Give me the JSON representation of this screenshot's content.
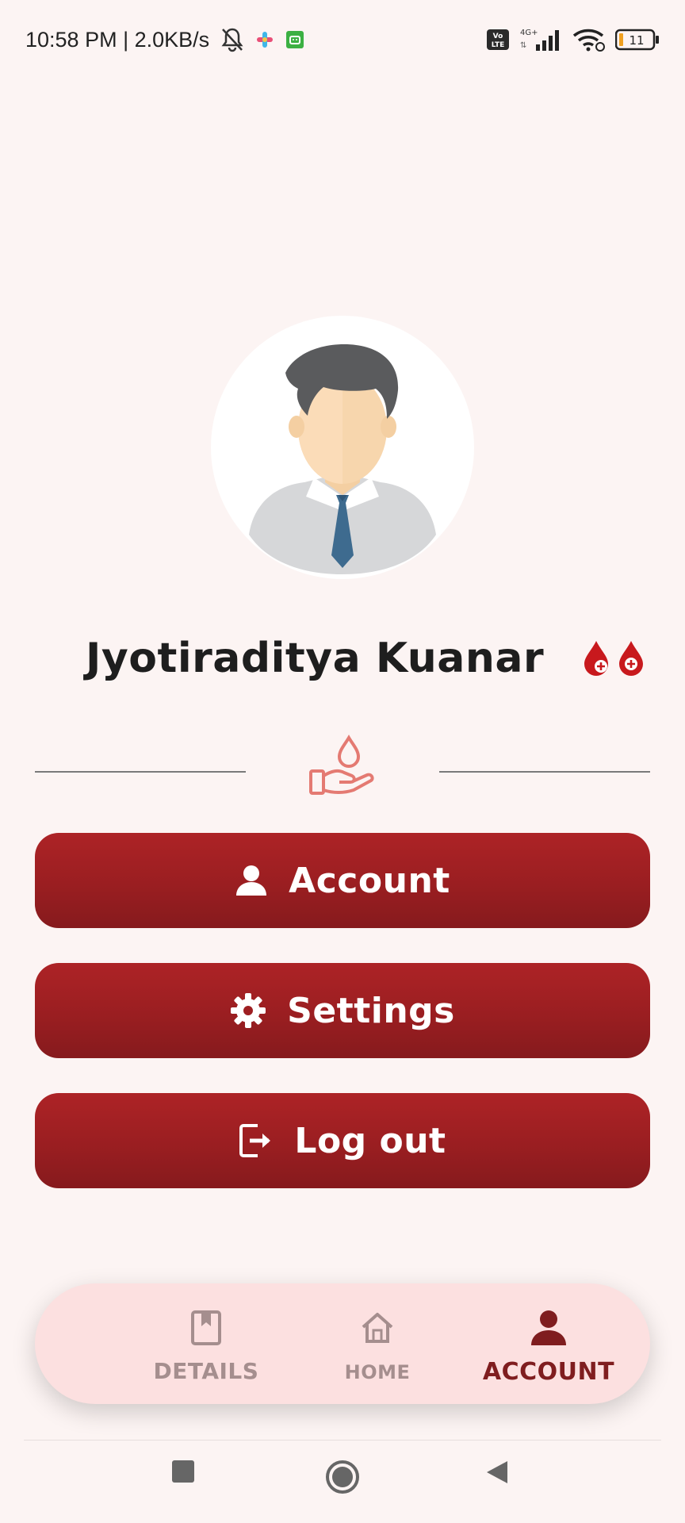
{
  "status_bar": {
    "time_speed": "10:58 PM | 2.0KB/s",
    "network": "4G+",
    "volte": "Vo LTE",
    "battery": "11",
    "icons": [
      "bell-off-icon",
      "app-icon",
      "android-icon",
      "volte-icon",
      "signal-icon",
      "wifi-icon",
      "battery-icon"
    ]
  },
  "profile": {
    "name": "Jyotiraditya Kuanar",
    "avatar_icon": "user-avatar",
    "badge_icons": [
      "blood-drop-plus-icon",
      "blood-drop-plus-icon"
    ]
  },
  "divider": {
    "icon": "hand-blood-drop-icon"
  },
  "menu": {
    "account_label": "Account",
    "settings_label": "Settings",
    "logout_label": "Log out"
  },
  "bottom_nav": {
    "details_label": "DETAILS",
    "home_label": "HOME",
    "account_label": "ACCOUNT",
    "active": "ACCOUNT"
  },
  "colors": {
    "background": "#fcf4f3",
    "button": "#9a1e21",
    "nav_bg": "#fce0e0",
    "nav_active": "#7f1d1f",
    "nav_inactive": "#a58e8e"
  }
}
